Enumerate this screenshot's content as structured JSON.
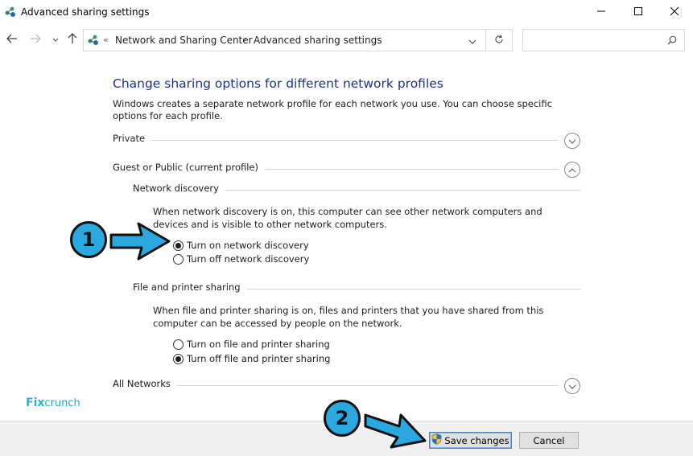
{
  "window": {
    "title": "Advanced sharing settings",
    "controls": {
      "minimize": "minimize-icon",
      "maximize": "maximize-icon",
      "close": "close-icon"
    }
  },
  "address_bar": {
    "overflow": "«",
    "crumbs": [
      "Network and Sharing Center",
      "Advanced sharing settings"
    ],
    "separator": "›",
    "search_placeholder": ""
  },
  "main": {
    "heading": "Change sharing options for different network profiles",
    "description": "Windows creates a separate network profile for each network you use. You can choose specific options for each profile.",
    "profiles": {
      "private": {
        "label": "Private",
        "expanded": false
      },
      "guest_public": {
        "label": "Guest or Public (current profile)",
        "expanded": true,
        "network_discovery": {
          "title": "Network discovery",
          "text": "When network discovery is on, this computer can see other network computers and devices and is visible to other network computers.",
          "options": [
            {
              "label": "Turn on network discovery",
              "checked": true
            },
            {
              "label": "Turn off network discovery",
              "checked": false
            }
          ]
        },
        "file_printer_sharing": {
          "title": "File and printer sharing",
          "text": "When file and printer sharing is on, files and printers that you have shared from this computer can be accessed by people on the network.",
          "options": [
            {
              "label": "Turn on file and printer sharing",
              "checked": false
            },
            {
              "label": "Turn off file and printer sharing",
              "checked": true
            }
          ]
        }
      },
      "all_networks": {
        "label": "All Networks",
        "expanded": false
      }
    }
  },
  "footer": {
    "save_label": "Save changes",
    "cancel_label": "Cancel"
  },
  "watermark": {
    "brand_a": "Fix",
    "brand_b": "crunch"
  },
  "annotations": [
    {
      "number": "1"
    },
    {
      "number": "2"
    }
  ],
  "colors": {
    "heading": "#1e3287",
    "marker_fill": "#2aa8e0",
    "watermark": "#27b3d6"
  }
}
